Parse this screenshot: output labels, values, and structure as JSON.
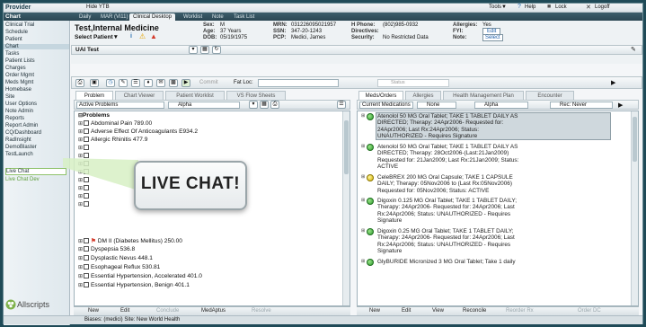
{
  "brand": "Provider",
  "top_left_label": "Chart",
  "hide_label": "Hide YTB",
  "top_tabs": [
    "Daily",
    "MAR (Vi11)",
    "Clinical Desktop",
    "Worklist",
    "Note",
    "Task List"
  ],
  "top_right": {
    "tools": "Tools▼",
    "help": "Help",
    "lock": "Lock",
    "logoff": "Logoff"
  },
  "left_nav": [
    "Clinical Trial",
    "Schedule",
    "Patient",
    "Chart",
    "Tasks",
    "Patient Lists",
    "Charges",
    "Order Mgmt",
    "Meds Mgmt",
    "Homebase",
    "Site",
    "User Options",
    "Note Admin",
    "Reports",
    "Report Admin",
    "CQ/Dashboard",
    "RadInsight",
    "DemoBlaster",
    "TestLaunch",
    "",
    "Live Chat",
    "Live Chat Dev"
  ],
  "patient": {
    "name": "Test,Internal Medicine",
    "select_label": "Select Patient▼",
    "sex_label": "Sex:",
    "sex": "M",
    "age_label": "Age:",
    "age": "37 Years",
    "dob_label": "DOB:",
    "dob": "05/19/1975",
    "mrn_label": "MRN:",
    "mrn": "031226095021957",
    "ssn_label": "SSN:",
    "ssn": "347-20-1243",
    "pcp_label": "PCP:",
    "pcp": "Medici, James",
    "hphone_label": "H Phone:",
    "hphone": "(802)985-0932",
    "directives_label": "Directives:",
    "security_label": "Security:",
    "security": "No Restricted Data",
    "allergies_label": "Allergies:",
    "allergies": "Yes",
    "fyi_label": "FYI:",
    "fyi": "Edit",
    "note_label": "Note:",
    "note": "Select"
  },
  "list_select": "UAI Test",
  "toolbar2": {
    "commit": "Commit",
    "fat_loc": "Fat Loc:",
    "status": "Status"
  },
  "left_tabs": [
    "Problem",
    "Chart Viewer",
    "Patient Worklist",
    "VS Flow Sheets"
  ],
  "left_filter": {
    "type": "Active Problems",
    "sort": "Alpha"
  },
  "problems_header": "Problems",
  "problems": [
    "Abdominal Pain 789.00",
    "Adverse Effect Of Anticoagulants E934.2",
    "Allergic Rhinitis 477.9",
    "",
    "",
    "",
    "",
    "",
    "",
    "",
    "DM II (Diabetes Mellitus) 250.00",
    "Dyspepsia 536.8",
    "Dysplastic Nevus 448.1",
    "Esophageal Reflux 530.81",
    "Essential Hypertension, Accelerated 401.0",
    "Essential Hypertension, Benign 401.1"
  ],
  "left_bottom": [
    "New",
    "Edit",
    "Conclude",
    "MedAptus",
    "Resolve"
  ],
  "right_tabs": [
    "Meds/Orders",
    "Allergies",
    "Health Management Plan",
    "Encounter"
  ],
  "right_filter": {
    "type": "Current Medications",
    "group": "None",
    "sort": "Alpha",
    "rec": "Rec: Never"
  },
  "meds": [
    {
      "lines": [
        "Atenolol 50 MG Oral Tablet; TAKE 1 TABLET DAILY AS",
        "DIRECTED; Therapy: 24Apr2006- Requested for:",
        "24Apr2006; Last Rx:24Apr2006; Status:",
        "UNAUTHORIZED - Requires Signature"
      ],
      "icon": "green",
      "selected": true
    },
    {
      "lines": [
        "Atenolol 50 MG Oral Tablet; TAKE 1 TABLET DAILY AS",
        "DIRECTED; Therapy: 28Oct2006-(Last:21Jan2009)",
        "Requested for: 21Jan2009; Last Rx:21Jan2009; Status:",
        "ACTIVE"
      ],
      "icon": "green",
      "selected": false
    },
    {
      "lines": [
        "CeleBREX 200 MG Oral Capsule; TAKE 1 CAPSULE",
        "DAILY; Therapy: 05Nov2006 to (Last Rx:05Nov2006)",
        "Requested for: 05Nov2006; Status: ACTIVE"
      ],
      "icon": "yellow",
      "selected": false
    },
    {
      "lines": [
        "Digoxin 0.125 MG Oral Tablet; TAKE 1 TABLET DAILY;",
        "Therapy: 24Apr2006- Requested for: 24Apr2006; Last",
        "Rx:24Apr2006; Status: UNAUTHORIZED - Requires",
        "Signature"
      ],
      "icon": "green",
      "selected": false
    },
    {
      "lines": [
        "Digoxin 0.25 MG Oral Tablet; TAKE 1 TABLET DAILY;",
        "Therapy: 24Apr2006- Requested for: 24Apr2006; Last",
        "Rx:24Apr2006; Status: UNAUTHORIZED - Requires",
        "Signature"
      ],
      "icon": "green",
      "selected": false
    },
    {
      "lines": [
        "GlyBURIDE Micronized 3 MG Oral Tablet; Take 1 daily"
      ],
      "icon": "green",
      "selected": false
    }
  ],
  "right_bottom": [
    "New",
    "Edit",
    "View",
    "Reconcile",
    "Reorder Rx",
    "Order DC"
  ],
  "allscripts": "Allscripts",
  "status_text": "Biases: (medici) Site: New World Health",
  "live_chat_banner": "LIVE CHAT!",
  "colors": {
    "frame": "#1f4a57",
    "accent": "#5e9e3a",
    "med_selected": "#cfd8dd"
  }
}
